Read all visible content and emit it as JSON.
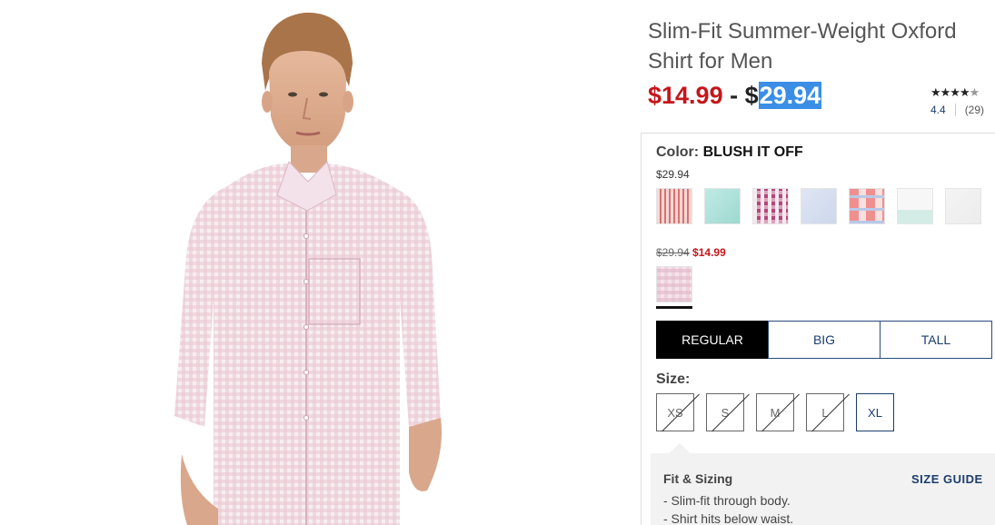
{
  "product": {
    "title": "Slim-Fit Summer-Weight Oxford Shirt for Men",
    "price_sale": "$14.99",
    "price_dash": " - ",
    "price_high_symbol": "$",
    "price_high_value": "29.94"
  },
  "rating": {
    "stars": "★★★★",
    "half_star": "★",
    "score": "4.4",
    "count": "(29)"
  },
  "color": {
    "label": "Color:",
    "name": "BLUSH IT OFF",
    "regular_price": "$29.94",
    "swatches": [
      {
        "name": "red-stripe",
        "color_a": "#f4d7d6",
        "color_b": "#d9736d"
      },
      {
        "name": "aqua",
        "color_a": "#bfeae4",
        "color_b": "#9ed9d0"
      },
      {
        "name": "berry-gingham",
        "color_a": "#b5477a",
        "color_b": "#f2e3ea"
      },
      {
        "name": "light-blue",
        "color_a": "#dfe6f3",
        "color_b": "#cdd7ec"
      },
      {
        "name": "coral-plaid",
        "color_a": "#f08f8f",
        "color_b": "#b9c8e8"
      },
      {
        "name": "mint-white",
        "color_a": "#f7f7f7",
        "color_b": "#d3ede6"
      },
      {
        "name": "white",
        "color_a": "#f4f4f4",
        "color_b": "#ececec"
      }
    ],
    "sale_old_price": "$29.94",
    "sale_new_price": "$14.99",
    "selected_swatch": {
      "name": "blush-gingham",
      "color_a": "#f6e3ea",
      "color_b": "#e0b7c7"
    }
  },
  "fit_tabs": [
    "REGULAR",
    "BIG",
    "TALL"
  ],
  "active_fit": "REGULAR",
  "size": {
    "label": "Size:",
    "options": [
      {
        "label": "XS",
        "available": false
      },
      {
        "label": "S",
        "available": false
      },
      {
        "label": "M",
        "available": false
      },
      {
        "label": "L",
        "available": false
      },
      {
        "label": "XL",
        "available": true
      }
    ]
  },
  "fit_sizing": {
    "title": "Fit & Sizing",
    "guide_label": "SIZE GUIDE",
    "notes": [
      "-  Slim-fit through body.",
      "-  Shirt hits below waist."
    ]
  }
}
